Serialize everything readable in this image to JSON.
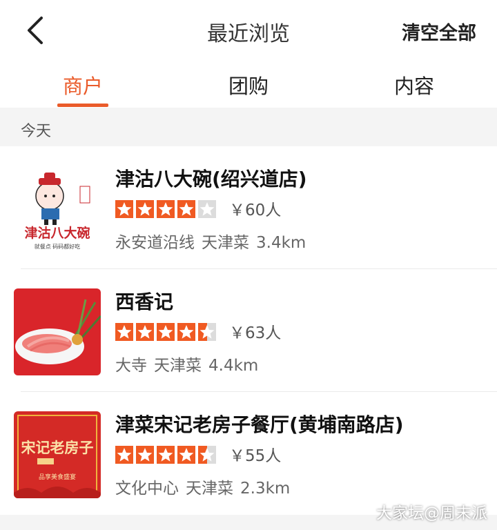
{
  "header": {
    "title": "最近浏览",
    "clear_label": "清空全部",
    "back_icon": "back-arrow-icon"
  },
  "tabs": [
    {
      "label": "商户",
      "active": true
    },
    {
      "label": "团购",
      "active": false
    },
    {
      "label": "内容",
      "active": false
    }
  ],
  "section": {
    "label": "今天"
  },
  "items": [
    {
      "name": "津沽八大碗(绍兴道店)",
      "rating": 4,
      "price": "￥60人",
      "area": "永安道沿线",
      "cuisine": "天津菜",
      "distance": "3.4km",
      "thumb": {
        "brand": "津沽八大碗",
        "slogan": "就餐点 码码都好吃"
      }
    },
    {
      "name": "西香记",
      "rating": 4.5,
      "price": "￥63人",
      "area": "大寺",
      "cuisine": "天津菜",
      "distance": "4.4km"
    },
    {
      "name": "津菜宋记老房子餐厅(黄埔南路店)",
      "rating": 4.5,
      "price": "￥55人",
      "area": "文化中心",
      "cuisine": "天津菜",
      "distance": "2.3km",
      "thumb": {
        "brand": "宋记老房子",
        "sub": "品享美食盛宴"
      }
    }
  ],
  "watermark": "大家坛@周末派",
  "colors": {
    "accent": "#ea5b2a",
    "star": "#f05a22",
    "star_empty": "#dcdcdc"
  }
}
